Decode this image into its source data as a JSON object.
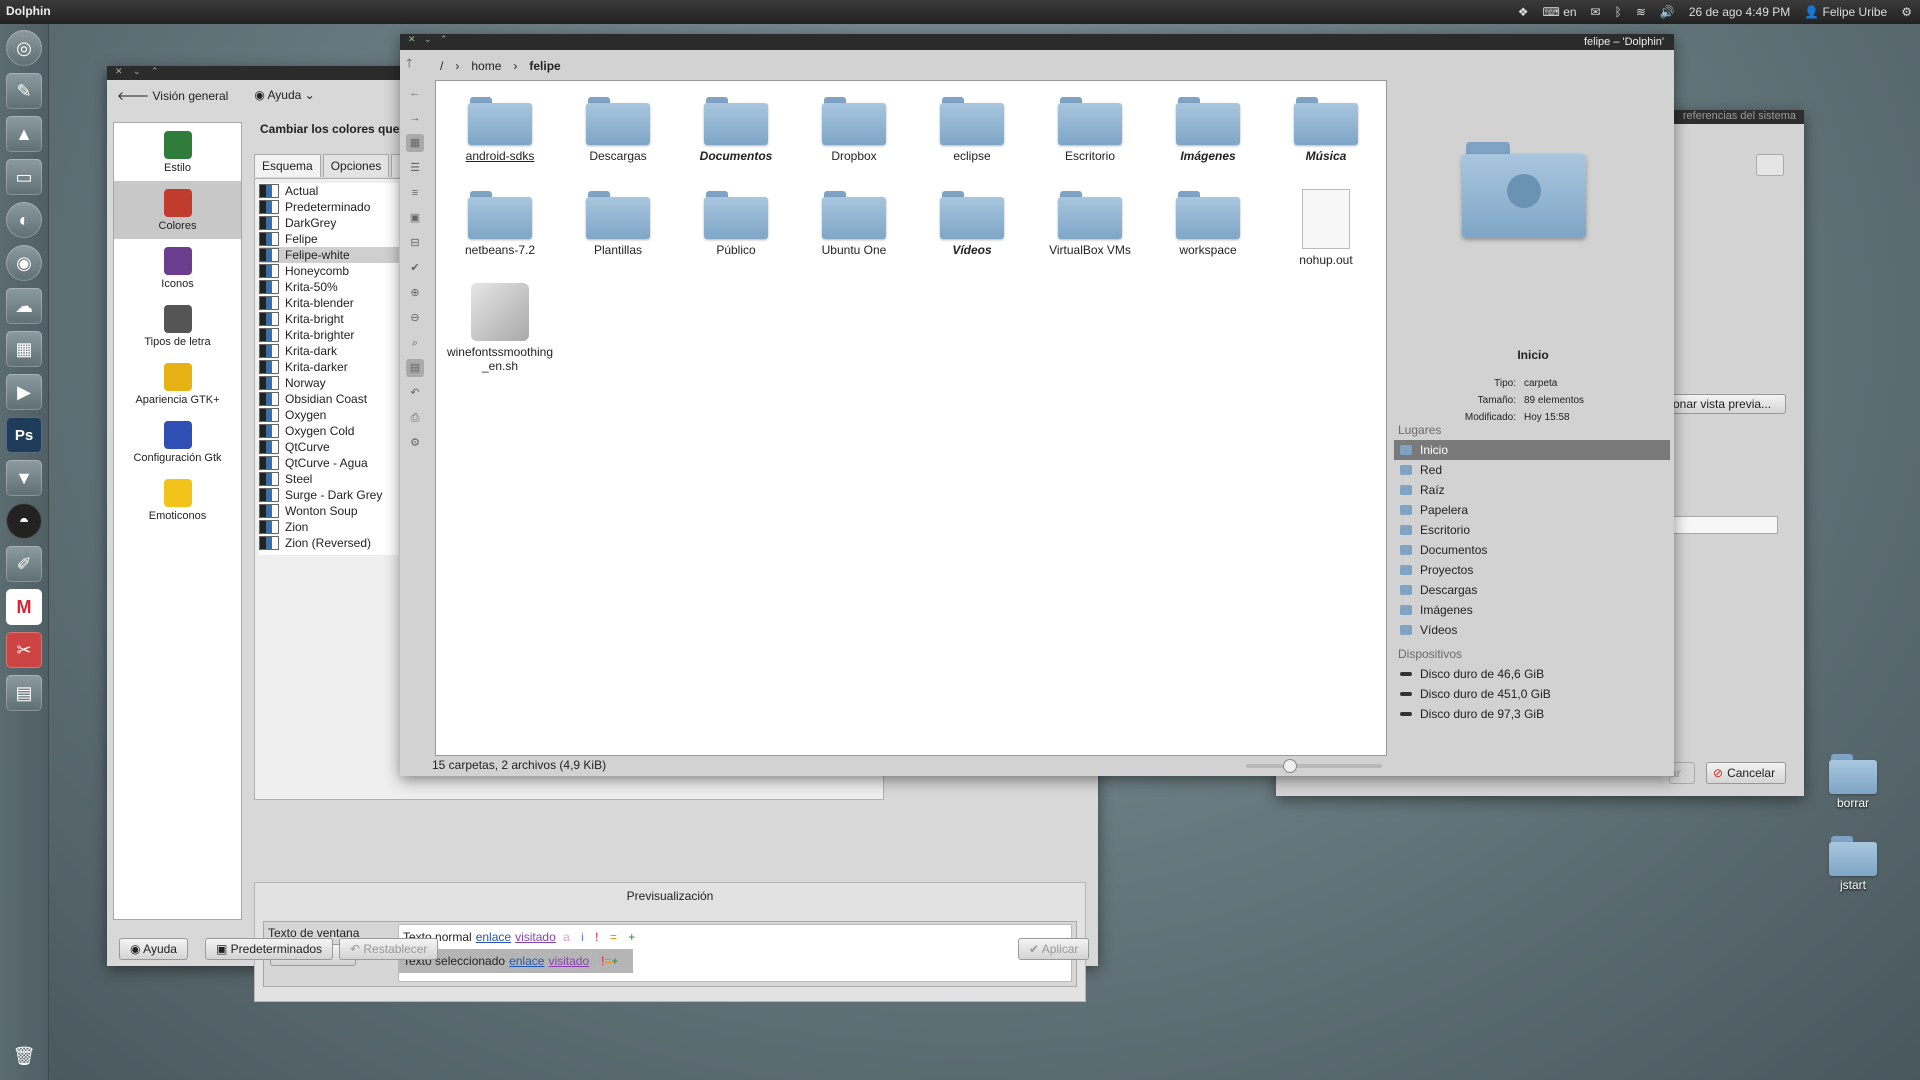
{
  "top_panel": {
    "app_name": "Dolphin",
    "keyboard_layout": "en",
    "datetime": "26 de ago  4:49 PM",
    "user": "Felipe Uribe"
  },
  "launcher": {
    "items": [
      "dash-icon",
      "text-editor-icon",
      "inkscape-icon",
      "files-icon",
      "firefox-icon",
      "chromium-icon",
      "cloud-icon",
      "calculator-icon",
      "terminal-icon",
      "photoshop-icon",
      "ballot-icon",
      "app-icon",
      "brush-icon",
      "gmail-icon",
      "tools-icon",
      "window-icon",
      "trash-icon"
    ],
    "ps_label": "Ps",
    "gmail_label": "M"
  },
  "settings": {
    "toolbar": {
      "overview": "Visión general",
      "help": "Ayuda"
    },
    "categories": [
      {
        "label": "Estilo",
        "color": "#2f7d3b"
      },
      {
        "label": "Colores",
        "color": "#c23b2f"
      },
      {
        "label": "Iconos",
        "color": "#6b3d8f"
      },
      {
        "label": "Tipos de letra",
        "color": "#555555"
      },
      {
        "label": "Apariencia GTK+",
        "color": "#e7b213"
      },
      {
        "label": "Configuración Gtk",
        "color": "#2f4fb5"
      },
      {
        "label": "Emoticonos",
        "color": "#f2c41a"
      }
    ],
    "heading": "Cambiar los colores que usan",
    "tabs": [
      "Esquema",
      "Opciones",
      "Col"
    ],
    "schemes": [
      "Actual",
      "Predeterminado",
      "DarkGrey",
      "Felipe",
      "Felipe-white",
      "Honeycomb",
      "Krita-50%",
      "Krita-blender",
      "Krita-bright",
      "Krita-brighter",
      "Krita-dark",
      "Krita-darker",
      "Norway",
      "Obsidian Coast",
      "Oxygen",
      "Oxygen Cold",
      "QtCurve",
      "QtCurve - Agua",
      "Steel",
      "Surge - Dark Grey",
      "Wonton Soup",
      "Zion",
      "Zion (Reversed)"
    ],
    "selected_scheme": "Felipe-white",
    "preview": {
      "title": "Previsualización",
      "window_text": "Texto de ventana",
      "button": "Botón",
      "normal_text": "Texto normal",
      "selected_text": "Texto seleccionado",
      "link": "enlace",
      "visited": "visitado",
      "marks": [
        "a",
        "i",
        "!",
        "=",
        "+"
      ]
    },
    "buttons": {
      "help": "Ayuda",
      "defaults": "Predeterminados",
      "reset": "Restablecer",
      "apply": "Aplicar"
    }
  },
  "back_window": {
    "title_fragment": "referencias del sistema",
    "preview_button": "onar vista previa...",
    "cancel": "Cancelar",
    "partial_apply": "ar"
  },
  "dolphin": {
    "title": "felipe – 'Dolphin'",
    "breadcrumb": [
      "/",
      "home",
      "felipe"
    ],
    "files": [
      {
        "name": "android-sdks",
        "kind": "folder",
        "style": "underline"
      },
      {
        "name": "Descargas",
        "kind": "folder",
        "style": "normal"
      },
      {
        "name": "Documentos",
        "kind": "folder",
        "style": "italic"
      },
      {
        "name": "Dropbox",
        "kind": "folder",
        "style": "normal"
      },
      {
        "name": "eclipse",
        "kind": "folder",
        "style": "normal"
      },
      {
        "name": "Escritorio",
        "kind": "folder",
        "style": "normal"
      },
      {
        "name": "Imágenes",
        "kind": "folder",
        "style": "italic"
      },
      {
        "name": "Música",
        "kind": "folder",
        "style": "italic"
      },
      {
        "name": "netbeans-7.2",
        "kind": "folder",
        "style": "normal"
      },
      {
        "name": "Plantillas",
        "kind": "folder",
        "style": "normal"
      },
      {
        "name": "Público",
        "kind": "folder",
        "style": "normal"
      },
      {
        "name": "Ubuntu One",
        "kind": "folder",
        "style": "normal"
      },
      {
        "name": "Vídeos",
        "kind": "folder",
        "style": "italic"
      },
      {
        "name": "VirtualBox VMs",
        "kind": "folder",
        "style": "normal"
      },
      {
        "name": "workspace",
        "kind": "folder",
        "style": "normal"
      },
      {
        "name": "nohup.out",
        "kind": "document",
        "style": "normal"
      },
      {
        "name": "winefontssmoothing_en.sh",
        "kind": "script",
        "style": "normal"
      }
    ],
    "status": "15 carpetas, 2 archivos (4,9 KiB)",
    "zoom_level": 0.3,
    "info": {
      "name": "Inicio",
      "type_label": "Tipo:",
      "type_value": "carpeta",
      "size_label": "Tamaño:",
      "size_value": "89 elementos",
      "modified_label": "Modificado:",
      "modified_value": "Hoy 15:58"
    },
    "places_title": "Lugares",
    "places": [
      "Inicio",
      "Red",
      "Raíz",
      "Papelera",
      "Escritorio",
      "Documentos",
      "Proyectos",
      "Descargas",
      "Imágenes",
      "Vídeos"
    ],
    "devices_title": "Dispositivos",
    "devices": [
      "Disco duro de 46,6 GiB",
      "Disco duro de 451,0 GiB",
      "Disco duro de 97,3 GiB"
    ]
  },
  "desktop": {
    "icons": [
      "borrar",
      "jstart"
    ]
  }
}
